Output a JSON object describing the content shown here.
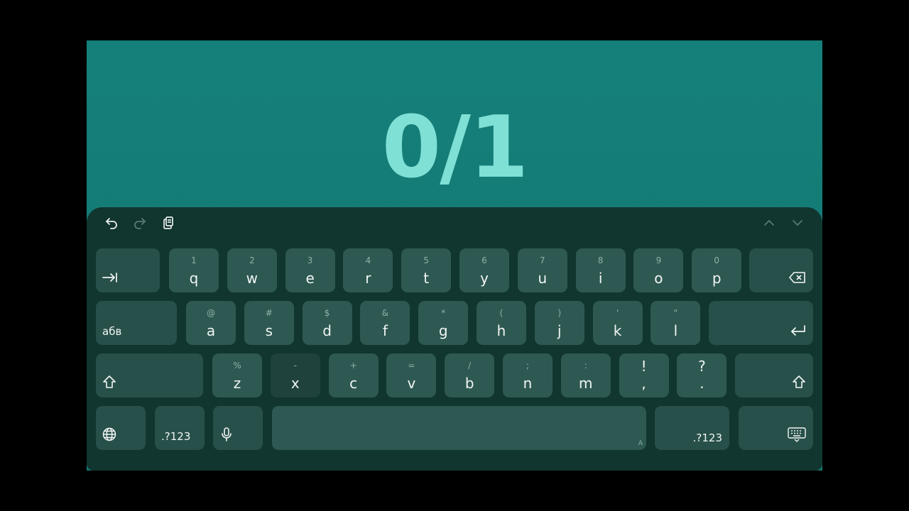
{
  "page": {
    "counter": "0/1"
  },
  "toolbar": {
    "undo_icon": "undo-icon",
    "redo_icon": "redo-icon",
    "clipboard_icon": "clipboard-icon",
    "collapse_up_icon": "chevron-up-icon",
    "collapse_down_icon": "chevron-down-icon"
  },
  "keyboard": {
    "row1": [
      {
        "hint": "1",
        "key": "q"
      },
      {
        "hint": "2",
        "key": "w"
      },
      {
        "hint": "3",
        "key": "e"
      },
      {
        "hint": "4",
        "key": "r"
      },
      {
        "hint": "5",
        "key": "t"
      },
      {
        "hint": "6",
        "key": "y"
      },
      {
        "hint": "7",
        "key": "u"
      },
      {
        "hint": "8",
        "key": "i"
      },
      {
        "hint": "9",
        "key": "o"
      },
      {
        "hint": "0",
        "key": "p"
      }
    ],
    "row2": [
      {
        "hint": "@",
        "key": "a"
      },
      {
        "hint": "#",
        "key": "s"
      },
      {
        "hint": "$",
        "key": "d"
      },
      {
        "hint": "&",
        "key": "f"
      },
      {
        "hint": "*",
        "key": "g"
      },
      {
        "hint": "(",
        "key": "h"
      },
      {
        "hint": ")",
        "key": "j"
      },
      {
        "hint": "'",
        "key": "k"
      },
      {
        "hint": "\"",
        "key": "l"
      }
    ],
    "row3": [
      {
        "hint": "%",
        "key": "z"
      },
      {
        "hint": "-",
        "key": "x"
      },
      {
        "hint": "+",
        "key": "c"
      },
      {
        "hint": "=",
        "key": "v"
      },
      {
        "hint": "/",
        "key": "b"
      },
      {
        "hint": ";",
        "key": "n"
      },
      {
        "hint": ":",
        "key": "m"
      },
      {
        "hint": "!",
        "key": ","
      },
      {
        "hint": "?",
        "key": "."
      }
    ],
    "language_key": "абв",
    "symbols_key_left": ".?123",
    "symbols_key_right": ".?123",
    "space_corner": "A",
    "tab_icon": "tab-icon",
    "backspace_icon": "backspace-icon",
    "enter_icon": "enter-icon",
    "shift_icon": "shift-icon",
    "globe_icon": "globe-icon",
    "mic_icon": "microphone-icon",
    "hide_keyboard_icon": "keyboard-hide-icon"
  },
  "colors": {
    "screen_bg": "#15807a",
    "keyboard_bg": "#11352f",
    "key_bg": "#2e5952",
    "counter_text": "#7fe0d6"
  }
}
